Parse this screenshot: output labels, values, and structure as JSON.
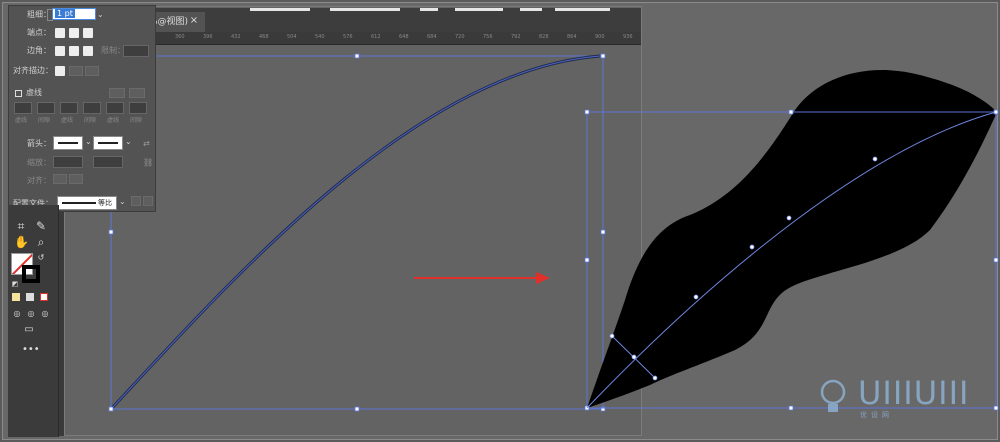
{
  "document_tab": {
    "label": "%@视图)",
    "close": "×"
  },
  "ruler_ticks": [
    "360",
    "396",
    "432",
    "468",
    "504",
    "540",
    "576",
    "612",
    "648",
    "684",
    "720",
    "756",
    "792",
    "828",
    "864",
    "900",
    "936"
  ],
  "stroke_panel": {
    "weight_label": "粗细：",
    "weight_value": "1 pt",
    "cap_label": "端点：",
    "corner_label": "边角：",
    "limit_label": "限制：",
    "align_label": "对齐描边：",
    "dashed_label": "虚线",
    "dash_labels": [
      "虚线",
      "间隙",
      "虚线",
      "间隙",
      "虚线",
      "间隙"
    ],
    "arrow_label": "箭头：",
    "scale_label": "缩放：",
    "align2_label": "对齐：",
    "profile_label": "配置文件：",
    "profile_value": "等比"
  },
  "colors": {
    "accent_arrow": "#e0302a",
    "path_blue": "#4a66c4",
    "selection_blue": "#5b74d6",
    "fill_black": "#000000",
    "watermark": "#8fb3d6"
  },
  "watermark": {
    "text": "UIIIUIII",
    "sub": "优设网"
  }
}
